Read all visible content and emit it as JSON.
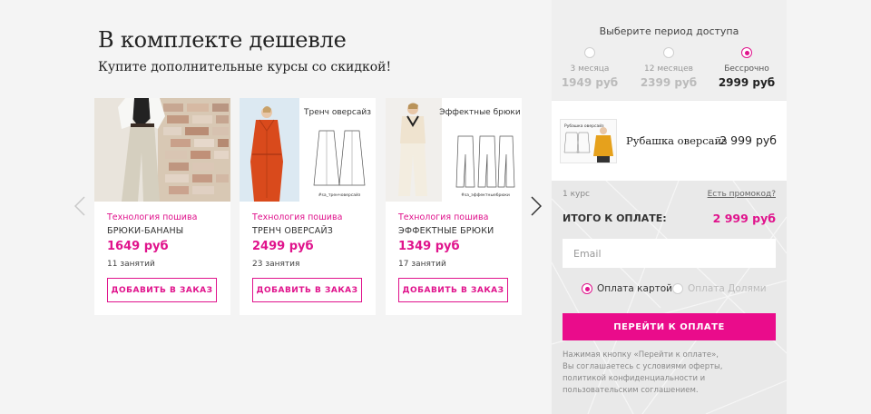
{
  "header": {
    "title": "В комплекте дешевле",
    "subtitle": "Купите дополнительные курсы со скидкой!"
  },
  "carousel": {
    "cards": [
      {
        "category": "Технология пошива",
        "name": "БРЮКИ-БАНАНЫ",
        "price": "1649 руб",
        "lessons": "11 занятий",
        "button": "ДОБАВИТЬ В ЗАКАЗ"
      },
      {
        "category": "Технология пошива",
        "name": "ТРЕНЧ ОВЕРСАЙЗ",
        "price": "2499 руб",
        "lessons": "23 занятия",
        "button": "ДОБАВИТЬ В ЗАКАЗ",
        "image_title": "Тренч оверсайз",
        "image_tag": "#sa_тренчоверсайз"
      },
      {
        "category": "Технология пошива",
        "name": "ЭФФЕКТНЫЕ БРЮКИ",
        "price": "1349 руб",
        "lessons": "17 занятий",
        "button": "ДОБАВИТЬ В ЗАКАЗ",
        "image_title": "Эффектные брюки",
        "image_tag": "#sa_эффектныебрюки"
      }
    ]
  },
  "access": {
    "title": "Выберите период доступа",
    "options": [
      {
        "label": "3 месяца",
        "price": "1949 руб",
        "selected": false
      },
      {
        "label": "12 месяцев",
        "price": "2399 руб",
        "selected": false
      },
      {
        "label": "Бессрочно",
        "price": "2999 руб",
        "selected": true
      }
    ]
  },
  "order": {
    "product_name": "Рубашка оверсайз",
    "product_price": "2 999 руб",
    "product_thumb_title": "Рубашка оверсайз",
    "count": "1 курс",
    "promo_link": "Есть промокод?",
    "total_label": "ИТОГО К ОПЛАТЕ:",
    "total_value": "2 999 руб",
    "email_placeholder": "Email",
    "payment_card": "Оплата картой",
    "payment_parts": "Оплата Долями",
    "pay_button": "ПЕРЕЙТИ К ОПЛАТЕ",
    "note_lines": [
      "Нажимая кнопку «Перейти к оплате»,",
      "Вы соглашаетесь с условиями оферты,",
      "политикой конфиденциальности и",
      "пользовательским соглашением."
    ]
  },
  "colors": {
    "accent": "#e0138c",
    "button": "#ea0c8b"
  }
}
